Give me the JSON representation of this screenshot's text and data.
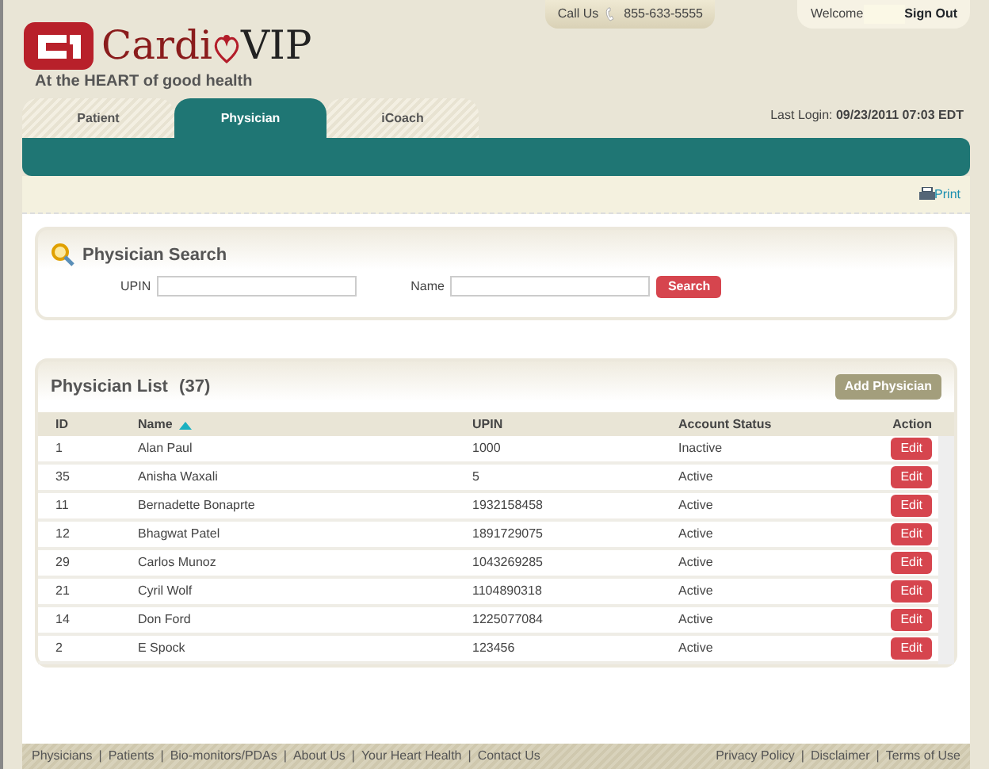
{
  "header": {
    "logo_left": "Cardi",
    "logo_right": "VIP",
    "tagline": "At the **HEART** of good health",
    "call_label": "Call Us",
    "phone": "855-633-5555",
    "welcome": "Welcome",
    "sign_out": "Sign Out",
    "last_login_label": "Last Login:",
    "last_login": "09/23/2011 07:03 EDT"
  },
  "tabs": [
    {
      "label": "Patient",
      "selected": false
    },
    {
      "label": "Physician",
      "selected": true
    },
    {
      "label": "iCoach",
      "selected": false
    }
  ],
  "print": "Print",
  "search": {
    "title": "Physician Search",
    "upin_label": "UPIN",
    "name_label": "Name",
    "button": "Search"
  },
  "list": {
    "title": "Physician List",
    "count": "(37)",
    "add_button": "Add Physician",
    "columns": [
      "ID",
      "Name",
      "UPIN",
      "Account Status",
      "Action"
    ],
    "rows": [
      {
        "id": "1",
        "name": "Alan Paul",
        "upin": "1000",
        "status": "Inactive",
        "action": "Edit"
      },
      {
        "id": "35",
        "name": "Anisha Waxali",
        "upin": "5",
        "status": "Active",
        "action": "Edit"
      },
      {
        "id": "11",
        "name": "Bernadette Bonaprte",
        "upin": "1932158458",
        "status": "Active",
        "action": "Edit"
      },
      {
        "id": "12",
        "name": "Bhagwat Patel",
        "upin": "1891729075",
        "status": "Active",
        "action": "Edit"
      },
      {
        "id": "29",
        "name": "Carlos Munoz",
        "upin": "1043269285",
        "status": "Active",
        "action": "Edit"
      },
      {
        "id": "21",
        "name": "Cyril Wolf",
        "upin": "1104890318",
        "status": "Active",
        "action": "Edit"
      },
      {
        "id": "14",
        "name": "Don Ford",
        "upin": "1225077084",
        "status": "Active",
        "action": "Edit"
      },
      {
        "id": "2",
        "name": "E Spock",
        "upin": "123456",
        "status": "Active",
        "action": "Edit"
      }
    ]
  },
  "footer": {
    "separator": "|",
    "left_links": [
      "Physicians",
      "Patients",
      "Bio-monitors/PDAs",
      "About Us",
      "Your Heart Health",
      "Contact Us"
    ],
    "right_links": [
      "Privacy Policy",
      "Disclaimer",
      "Terms of Use"
    ]
  }
}
